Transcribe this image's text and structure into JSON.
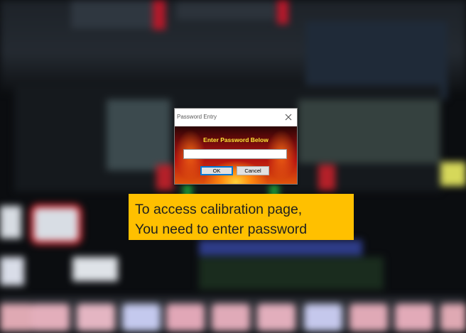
{
  "dialog": {
    "title": "Password Entry",
    "prompt": "Enter Password Below",
    "password_value": "",
    "ok_label": "OK",
    "cancel_label": "Cancel"
  },
  "callout": {
    "line1": "To access calibration page,",
    "line2": "You need to enter password",
    "color": "#ffc000"
  },
  "icons": {
    "close": "close-icon"
  }
}
